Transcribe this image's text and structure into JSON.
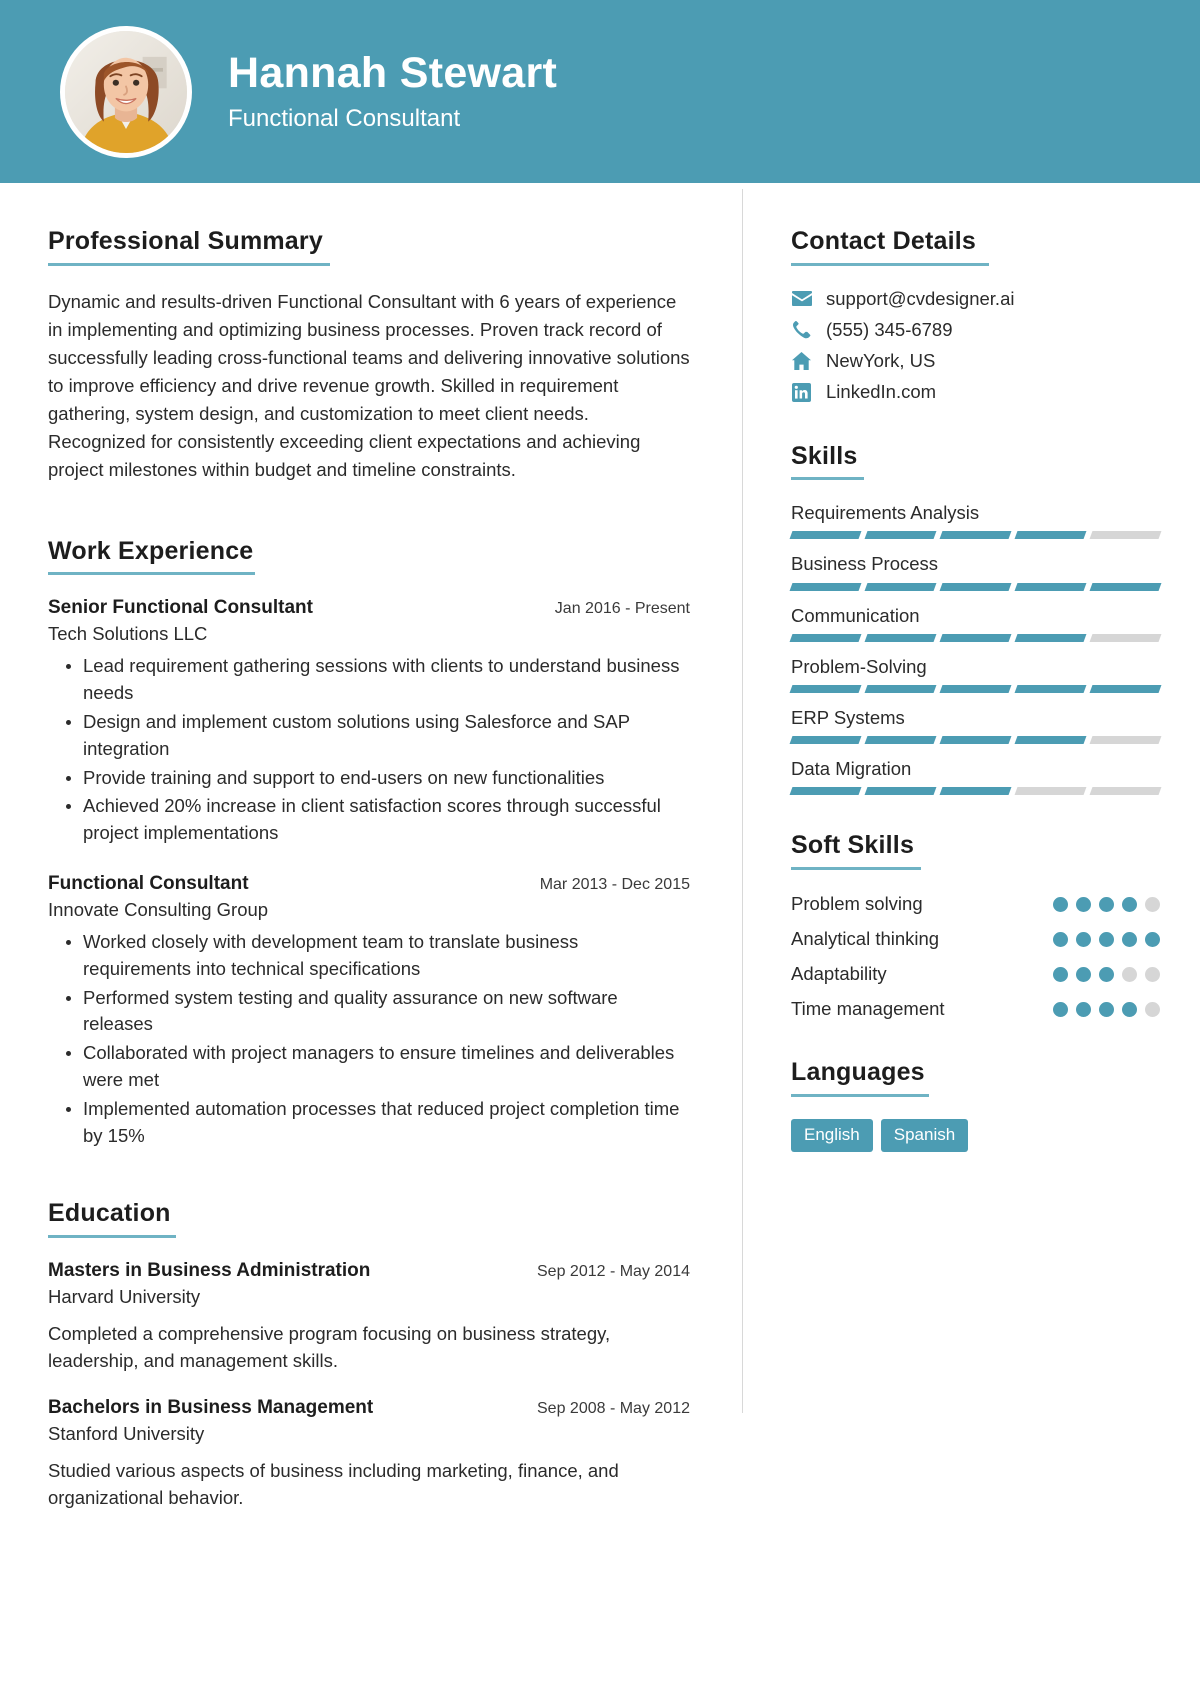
{
  "theme": {
    "accent": "#4c9cb3",
    "rule": "#6fb3c4",
    "bar_empty": "#d6d6d6",
    "text": "#2b2b2b",
    "heading": "#1d1d1d"
  },
  "header": {
    "name": "Hannah Stewart",
    "job_title": "Functional Consultant",
    "avatar_alt": "portrait-photo"
  },
  "summary": {
    "title": "Professional Summary",
    "text": "Dynamic and results-driven Functional Consultant with 6 years of experience in implementing and optimizing business processes. Proven track record of successfully leading cross-functional teams and delivering innovative solutions to improve efficiency and drive revenue growth. Skilled in requirement gathering, system design, and customization to meet client needs. Recognized for consistently exceeding client expectations and achieving project milestones within budget and timeline constraints."
  },
  "work": {
    "title": "Work Experience",
    "jobs": [
      {
        "role": "Senior Functional Consultant",
        "date": "Jan 2016 - Present",
        "company": "Tech Solutions LLC",
        "bullets": [
          "Lead requirement gathering sessions with clients to understand business needs",
          "Design and implement custom solutions using Salesforce and SAP integration",
          "Provide training and support to end-users on new functionalities",
          "Achieved 20% increase in client satisfaction scores through successful project implementations"
        ]
      },
      {
        "role": "Functional Consultant",
        "date": "Mar 2013 - Dec 2015",
        "company": "Innovate Consulting Group",
        "bullets": [
          "Worked closely with development team to translate business requirements into technical specifications",
          "Performed system testing and quality assurance on new software releases",
          "Collaborated with project managers to ensure timelines and deliverables were met",
          "Implemented automation processes that reduced project completion time by 15%"
        ]
      }
    ]
  },
  "education": {
    "title": "Education",
    "entries": [
      {
        "degree": "Masters in Business Administration",
        "date": "Sep 2012 - May 2014",
        "school": "Harvard University",
        "description": "Completed a comprehensive program focusing on business strategy, leadership, and management skills."
      },
      {
        "degree": "Bachelors in Business Management",
        "date": "Sep 2008 - May 2012",
        "school": "Stanford University",
        "description": "Studied various aspects of business including marketing, finance, and organizational behavior."
      }
    ]
  },
  "contact": {
    "title": "Contact Details",
    "items": [
      {
        "icon": "envelope-icon",
        "text": "support@cvdesigner.ai"
      },
      {
        "icon": "phone-icon",
        "text": "(555) 345-6789"
      },
      {
        "icon": "home-icon",
        "text": "NewYork, US"
      },
      {
        "icon": "linkedin-icon",
        "text": "LinkedIn.com"
      }
    ]
  },
  "skills": {
    "title": "Skills",
    "max": 5,
    "items": [
      {
        "name": "Requirements Analysis",
        "level": 4
      },
      {
        "name": "Business Process",
        "level": 5
      },
      {
        "name": "Communication",
        "level": 4
      },
      {
        "name": "Problem-Solving",
        "level": 5
      },
      {
        "name": "ERP Systems",
        "level": 4
      },
      {
        "name": "Data Migration",
        "level": 3
      }
    ]
  },
  "soft_skills": {
    "title": "Soft Skills",
    "max": 5,
    "items": [
      {
        "name": "Problem solving",
        "level": 4
      },
      {
        "name": "Analytical thinking",
        "level": 5
      },
      {
        "name": "Adaptability",
        "level": 3
      },
      {
        "name": "Time management",
        "level": 4
      }
    ]
  },
  "languages": {
    "title": "Languages",
    "items": [
      "English",
      "Spanish"
    ]
  }
}
